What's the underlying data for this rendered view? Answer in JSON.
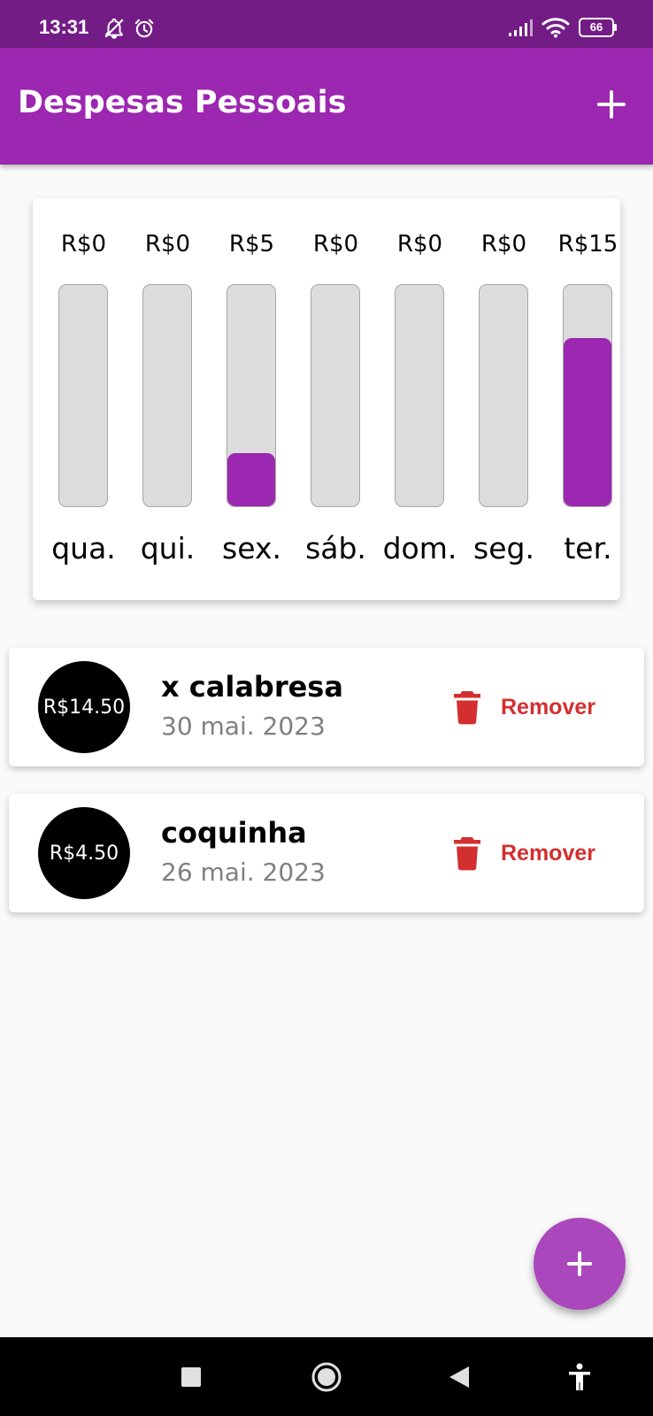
{
  "status_bar": {
    "time": "13:31",
    "battery": "66",
    "icons": [
      "notifications-off-icon",
      "alarm-icon",
      "signal-icon",
      "wifi-icon",
      "battery-icon"
    ]
  },
  "app_bar": {
    "title": "Despesas Pessoais",
    "add_icon": "plus-icon"
  },
  "colors": {
    "primary": "#9c27b0",
    "status_bar": "#741c86",
    "fab": "#ab47bc",
    "danger": "#d32f2f",
    "bar_track": "#dcdcdc"
  },
  "chart_data": {
    "type": "bar",
    "categories": [
      "qua.",
      "qui.",
      "sex.",
      "sáb.",
      "dom.",
      "seg.",
      "ter."
    ],
    "values": [
      0,
      0,
      5,
      0,
      0,
      0,
      15
    ],
    "value_labels": [
      "R$0",
      "R$0",
      "R$5",
      "R$0",
      "R$0",
      "R$0",
      "R$15"
    ],
    "fill_fraction": [
      0,
      0,
      0.24,
      0,
      0,
      0,
      0.76
    ]
  },
  "transactions": [
    {
      "amount": "R$14.50",
      "title": "x calabresa",
      "date": "30 mai. 2023",
      "remove_label": "Remover",
      "remove_icon": "trash-icon"
    },
    {
      "amount": "R$4.50",
      "title": "coquinha",
      "date": "26 mai. 2023",
      "remove_label": "Remover",
      "remove_icon": "trash-icon"
    }
  ],
  "fab": {
    "icon": "plus-icon"
  },
  "nav_bar": {
    "icons": [
      "recents-icon",
      "home-icon",
      "back-icon",
      "accessibility-icon"
    ]
  }
}
